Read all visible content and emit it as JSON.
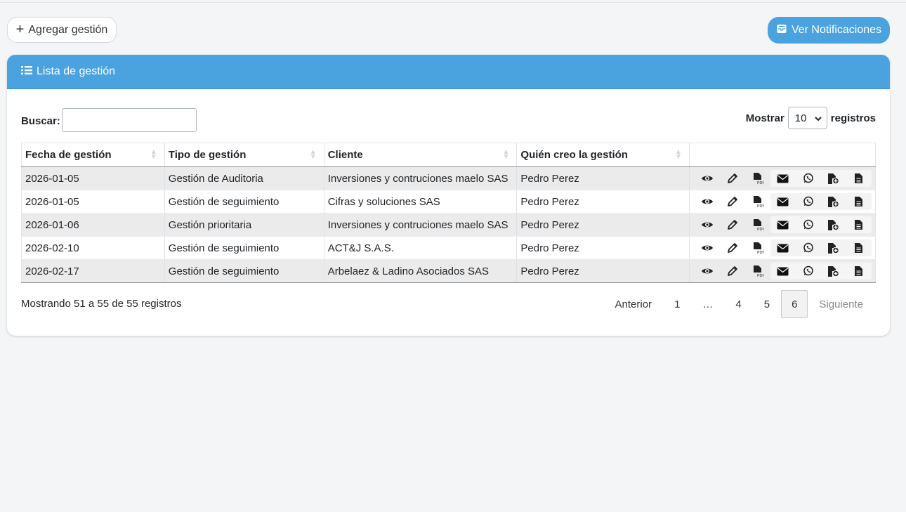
{
  "toolbar": {
    "add_label": "Agregar gestión",
    "notif_label": "Ver Notificaciones"
  },
  "card": {
    "title": "Lista de gestión"
  },
  "search": {
    "label": "Buscar:",
    "value": ""
  },
  "length": {
    "prefix": "Mostrar",
    "selected": "10",
    "suffix": "registros"
  },
  "table": {
    "headers": [
      "Fecha de gestión",
      "Tipo de gestión",
      "Cliente",
      "Quién creo la gestión"
    ],
    "rows": [
      [
        "2026-01-05",
        "Gestión de Auditoria",
        "Inversiones y contruciones maelo SAS",
        "Pedro Perez"
      ],
      [
        "2026-01-05",
        "Gestión de seguimiento",
        "Cifras y soluciones SAS",
        "Pedro Perez"
      ],
      [
        "2026-01-06",
        "Gestión prioritaria",
        "Inversiones y contruciones maelo SAS",
        "Pedro Perez"
      ],
      [
        "2026-02-10",
        "Gestión de seguimiento",
        "ACT&J S.A.S.",
        "Pedro Perez"
      ],
      [
        "2026-02-17",
        "Gestión de seguimiento",
        "Arbelaez & Ladino Asociados SAS",
        "Pedro Perez"
      ]
    ],
    "row_actions": [
      "eye-icon",
      "pencil-icon",
      "file-pdf-icon",
      "envelope-icon",
      "whatsapp-icon",
      "file-plus-icon",
      "file-text-icon"
    ]
  },
  "footer": {
    "info": "Mostrando 51 a 55 de 55 registros",
    "pagination": {
      "prev": "Anterior",
      "pages": [
        "1",
        "…",
        "4",
        "5",
        "6"
      ],
      "current": "6",
      "next": "Siguiente"
    }
  },
  "colors": {
    "accent": "#4aa3df",
    "page_bg": "#f4f5f7"
  }
}
